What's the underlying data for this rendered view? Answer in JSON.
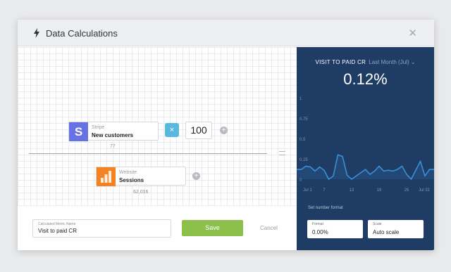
{
  "dialog": {
    "title": "Data Calculations"
  },
  "formula": {
    "numerator": {
      "source": "Stripe",
      "name": "New customers",
      "value": "77",
      "logo_char": "S"
    },
    "operator": "×",
    "multiplier": "100",
    "denominator": {
      "source": "Website",
      "name": "Sessions",
      "value": "62,016"
    }
  },
  "footer": {
    "name_label": "Calculated Metric Name",
    "name_value": "Visit to paid CR",
    "save_label": "Save",
    "cancel_label": "Cancel"
  },
  "preview": {
    "title": "VISIT TO PAID CR",
    "period": "Last Month (Jul) ⌄",
    "value": "0.12%",
    "set_format_label": "Set number format",
    "format": {
      "label": "Format",
      "value": "0.00%"
    },
    "scale": {
      "label": "Scale",
      "value": "Auto scale"
    }
  },
  "colors": {
    "panel": "#1e3c64",
    "line": "#3a8fd6",
    "save": "#8cc04b",
    "stripe": "#6772e5",
    "analytics": "#f58220"
  },
  "chart_data": {
    "type": "line",
    "x": [
      1,
      2,
      3,
      4,
      5,
      6,
      7,
      8,
      9,
      10,
      11,
      12,
      13,
      14,
      15,
      16,
      17,
      18,
      19,
      20,
      21,
      22,
      23,
      24,
      25,
      26,
      27,
      28,
      29,
      30,
      31
    ],
    "values": [
      0.12,
      0.12,
      0.16,
      0.15,
      0.1,
      0.15,
      0.11,
      0.0,
      0.04,
      0.3,
      0.28,
      0.05,
      0.0,
      0.04,
      0.08,
      0.12,
      0.06,
      0.1,
      0.16,
      0.1,
      0.11,
      0.1,
      0.12,
      0.16,
      0.06,
      0.0,
      0.11,
      0.22,
      0.04,
      0.12,
      0.12
    ],
    "ylim": [
      0,
      1
    ],
    "yticks": [
      "0",
      "0.25",
      "0.5",
      "0.75",
      "1"
    ],
    "xticks": [
      {
        "x": 1,
        "label": "Jul 1"
      },
      {
        "x": 7,
        "label": "7"
      },
      {
        "x": 13,
        "label": "13"
      },
      {
        "x": 19,
        "label": "19"
      },
      {
        "x": 25,
        "label": "25"
      },
      {
        "x": 31,
        "label": "Jul 31"
      }
    ],
    "grid": false
  }
}
